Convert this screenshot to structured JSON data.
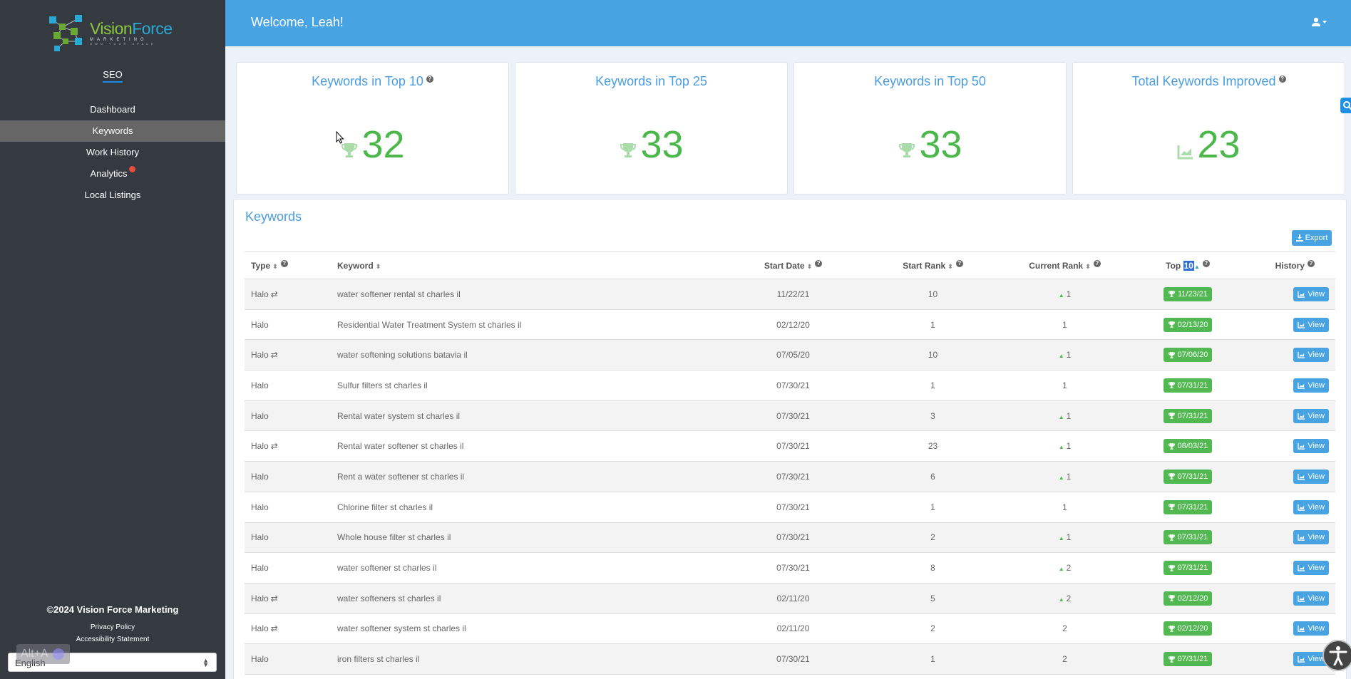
{
  "sidebar": {
    "logo": {
      "main_left": "Vision",
      "main_right": "Force",
      "sub": "MARKETING",
      "tagline": "OWN YOUR SPACE"
    },
    "section_label": "SEO",
    "items": [
      {
        "label": "Dashboard",
        "active": false
      },
      {
        "label": "Keywords",
        "active": true
      },
      {
        "label": "Work History",
        "active": false
      },
      {
        "label": "Analytics",
        "active": false,
        "notification": true
      },
      {
        "label": "Local Listings",
        "active": false
      }
    ],
    "footer": {
      "copyright": "©2024 Vision Force Marketing",
      "privacy": "Privacy Policy",
      "accessibility": "Accessibility Statement"
    },
    "language": {
      "selected": "English"
    },
    "alt_a_label": "Alt+A"
  },
  "topbar": {
    "welcome": "Welcome, Leah!"
  },
  "stats": [
    {
      "title": "Keywords in Top 10",
      "value": "32",
      "icon": "trophy-icon",
      "help": true
    },
    {
      "title": "Keywords in Top 25",
      "value": "33",
      "icon": "trophy-icon",
      "help": false
    },
    {
      "title": "Keywords in Top 50",
      "value": "33",
      "icon": "trophy-icon",
      "help": false
    },
    {
      "title": "Total Keywords Improved",
      "value": "23",
      "icon": "area-chart-icon",
      "help": true
    }
  ],
  "keywords": {
    "title": "Keywords",
    "export_label": "Export",
    "columns": {
      "type": "Type",
      "keyword": "Keyword",
      "start_date": "Start Date",
      "start_rank": "Start Rank",
      "current_rank": "Current Rank",
      "top_prefix": "Top",
      "top_value": "10",
      "history": "History"
    },
    "view_label": "View",
    "rows": [
      {
        "type": "Halo",
        "swap": true,
        "keyword": "water softener rental st charles il",
        "start_date": "11/22/21",
        "start_rank": "10",
        "current_rank": "1",
        "improved": true,
        "top_date": "11/23/21"
      },
      {
        "type": "Halo",
        "swap": false,
        "keyword": "Residential Water Treatment System st charles il",
        "start_date": "02/12/20",
        "start_rank": "1",
        "current_rank": "1",
        "improved": false,
        "top_date": "02/13/20"
      },
      {
        "type": "Halo",
        "swap": true,
        "keyword": "water softening solutions batavia il",
        "start_date": "07/05/20",
        "start_rank": "10",
        "current_rank": "1",
        "improved": true,
        "top_date": "07/06/20"
      },
      {
        "type": "Halo",
        "swap": false,
        "keyword": "Sulfur filters st charles il",
        "start_date": "07/30/21",
        "start_rank": "1",
        "current_rank": "1",
        "improved": false,
        "top_date": "07/31/21"
      },
      {
        "type": "Halo",
        "swap": false,
        "keyword": "Rental water system st charles il",
        "start_date": "07/30/21",
        "start_rank": "3",
        "current_rank": "1",
        "improved": true,
        "top_date": "07/31/21"
      },
      {
        "type": "Halo",
        "swap": true,
        "keyword": "Rental water softener st charles il",
        "start_date": "07/30/21",
        "start_rank": "23",
        "current_rank": "1",
        "improved": true,
        "top_date": "08/03/21"
      },
      {
        "type": "Halo",
        "swap": false,
        "keyword": "Rent a water softener st charles il",
        "start_date": "07/30/21",
        "start_rank": "6",
        "current_rank": "1",
        "improved": true,
        "top_date": "07/31/21"
      },
      {
        "type": "Halo",
        "swap": false,
        "keyword": "Chlorine filter st charles il",
        "start_date": "07/30/21",
        "start_rank": "1",
        "current_rank": "1",
        "improved": false,
        "top_date": "07/31/21"
      },
      {
        "type": "Halo",
        "swap": false,
        "keyword": "Whole house filter st charles il",
        "start_date": "07/30/21",
        "start_rank": "2",
        "current_rank": "1",
        "improved": true,
        "top_date": "07/31/21"
      },
      {
        "type": "Halo",
        "swap": false,
        "keyword": "water softener st charles il",
        "start_date": "07/30/21",
        "start_rank": "8",
        "current_rank": "2",
        "improved": true,
        "top_date": "07/31/21"
      },
      {
        "type": "Halo",
        "swap": true,
        "keyword": "water softeners st charles il",
        "start_date": "02/11/20",
        "start_rank": "5",
        "current_rank": "2",
        "improved": true,
        "top_date": "02/12/20"
      },
      {
        "type": "Halo",
        "swap": true,
        "keyword": "water softener system st charles il",
        "start_date": "02/11/20",
        "start_rank": "2",
        "current_rank": "2",
        "improved": false,
        "top_date": "02/12/20"
      },
      {
        "type": "Halo",
        "swap": false,
        "keyword": "iron filters st charles il",
        "start_date": "07/30/21",
        "start_rank": "1",
        "current_rank": "2",
        "improved": false,
        "top_date": "07/31/21"
      }
    ]
  },
  "colors": {
    "sidebar_bg": "#343a40",
    "topbar_bg": "#47a3e2",
    "accent_blue": "#4a9de0",
    "success_green": "#52b852",
    "notification_red": "#e74c3c"
  }
}
